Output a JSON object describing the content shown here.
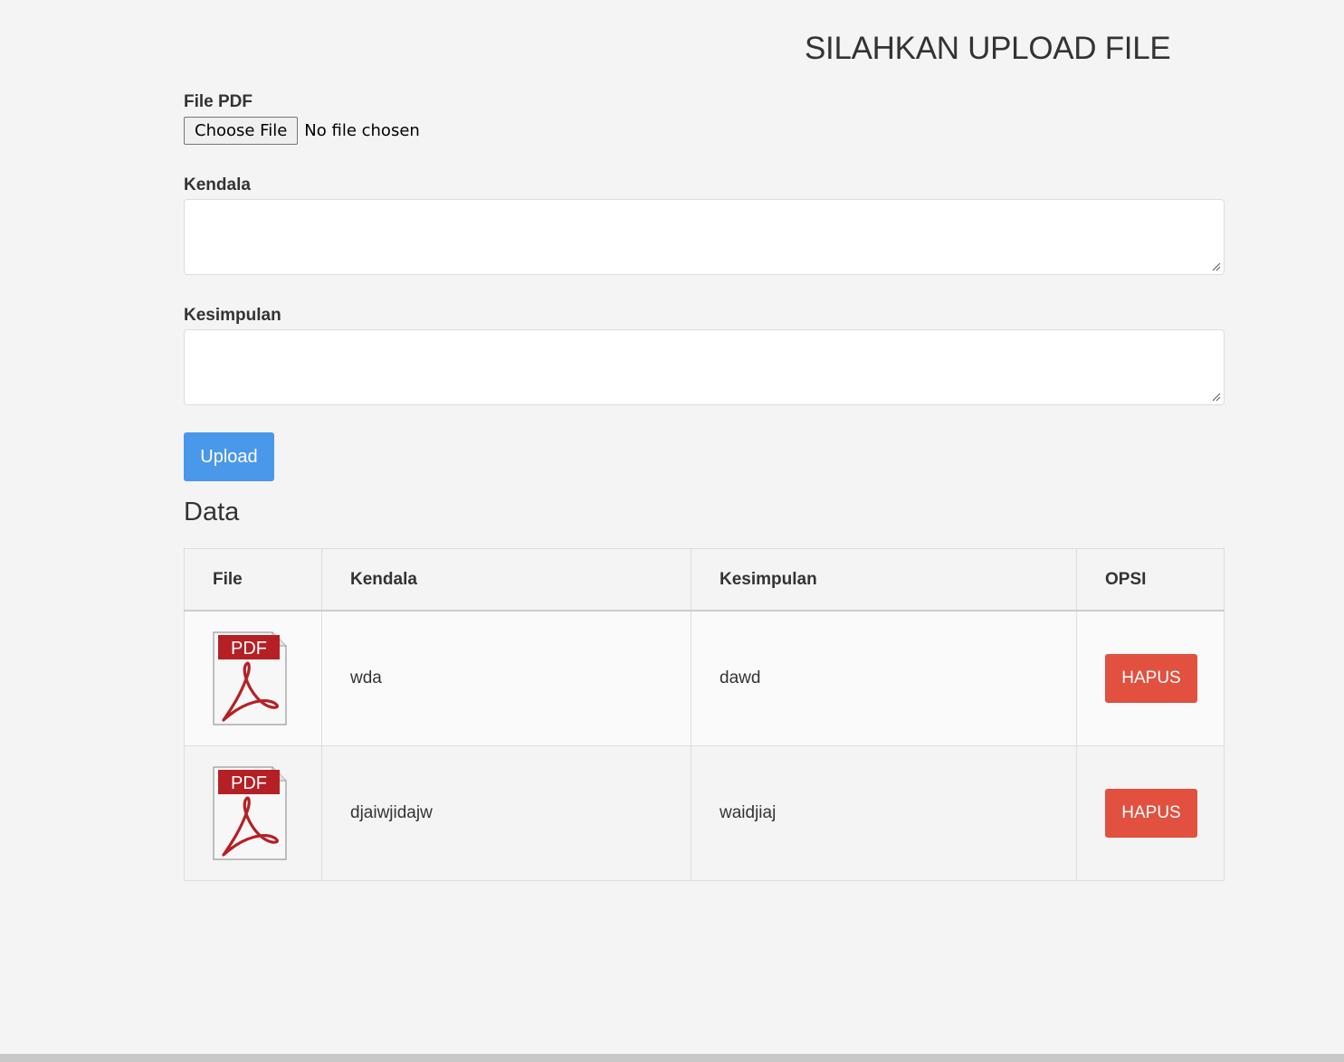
{
  "page": {
    "title": "SILAHKAN UPLOAD FILE"
  },
  "form": {
    "file_label": "File PDF",
    "file_button": "Choose File",
    "file_status": "No file chosen",
    "kendala_label": "Kendala",
    "kendala_value": "",
    "kesimpulan_label": "Kesimpulan",
    "kesimpulan_value": "",
    "upload_label": "Upload"
  },
  "data_section": {
    "heading": "Data",
    "columns": [
      "File",
      "Kendala",
      "Kesimpulan",
      "OPSI"
    ],
    "rows": [
      {
        "icon": "pdf-file-icon",
        "icon_text": "PDF",
        "kendala": "wda",
        "kesimpulan": "dawd",
        "action": "HAPUS"
      },
      {
        "icon": "pdf-file-icon",
        "icon_text": "PDF",
        "kendala": "djaiwjidajw",
        "kesimpulan": "waidjiaj",
        "action": "HAPUS"
      }
    ]
  },
  "colors": {
    "upload_button": "#4a98e9",
    "delete_button": "#e2503f",
    "background": "#f4f4f4"
  }
}
